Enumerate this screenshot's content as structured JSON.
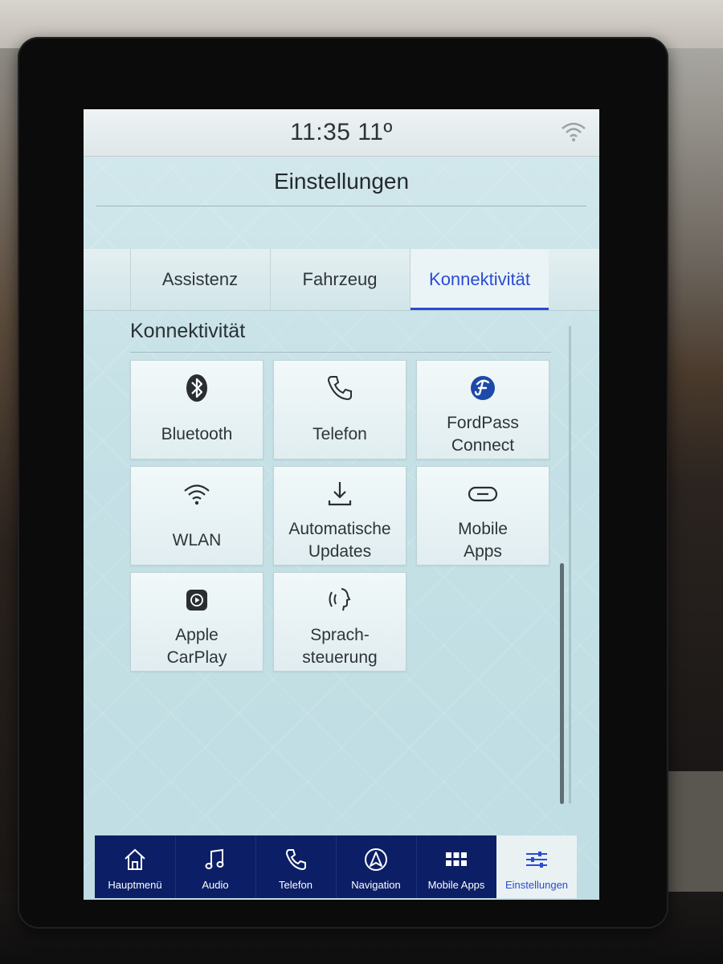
{
  "status": {
    "time_temp": "11:35  11º",
    "wifi_icon": "wifi-icon"
  },
  "title": "Einstellungen",
  "tabs": [
    {
      "label": "Assistenz",
      "active": false
    },
    {
      "label": "Fahrzeug",
      "active": false
    },
    {
      "label": "Konnektivität",
      "active": true
    }
  ],
  "section": {
    "heading": "Konnektivität",
    "tiles": [
      {
        "label": "Bluetooth",
        "icon": "bluetooth-icon"
      },
      {
        "label": "Telefon",
        "icon": "phone-icon"
      },
      {
        "label1": "FordPass",
        "label2": "Connect",
        "icon": "fordpass-icon"
      },
      {
        "label": "WLAN",
        "icon": "wifi-icon"
      },
      {
        "label1": "Automatische",
        "label2": "Updates",
        "icon": "download-icon"
      },
      {
        "label1": "Mobile",
        "label2": "Apps",
        "icon": "link-icon"
      },
      {
        "label1": "Apple",
        "label2": "CarPlay",
        "icon": "carplay-icon"
      },
      {
        "label1": "Sprach-",
        "label2": "steuerung",
        "icon": "voice-icon"
      }
    ]
  },
  "nav": [
    {
      "label": "Hauptmenü",
      "icon": "home-icon"
    },
    {
      "label": "Audio",
      "icon": "music-icon"
    },
    {
      "label": "Telefon",
      "icon": "phone-icon"
    },
    {
      "label": "Navigation",
      "icon": "navigation-icon"
    },
    {
      "label": "Mobile Apps",
      "icon": "apps-grid-icon"
    },
    {
      "label": "Einstellungen",
      "icon": "sliders-icon",
      "active": true
    }
  ],
  "colors": {
    "accent": "#2b4bd3",
    "nav_bg": "#0c1f66"
  }
}
